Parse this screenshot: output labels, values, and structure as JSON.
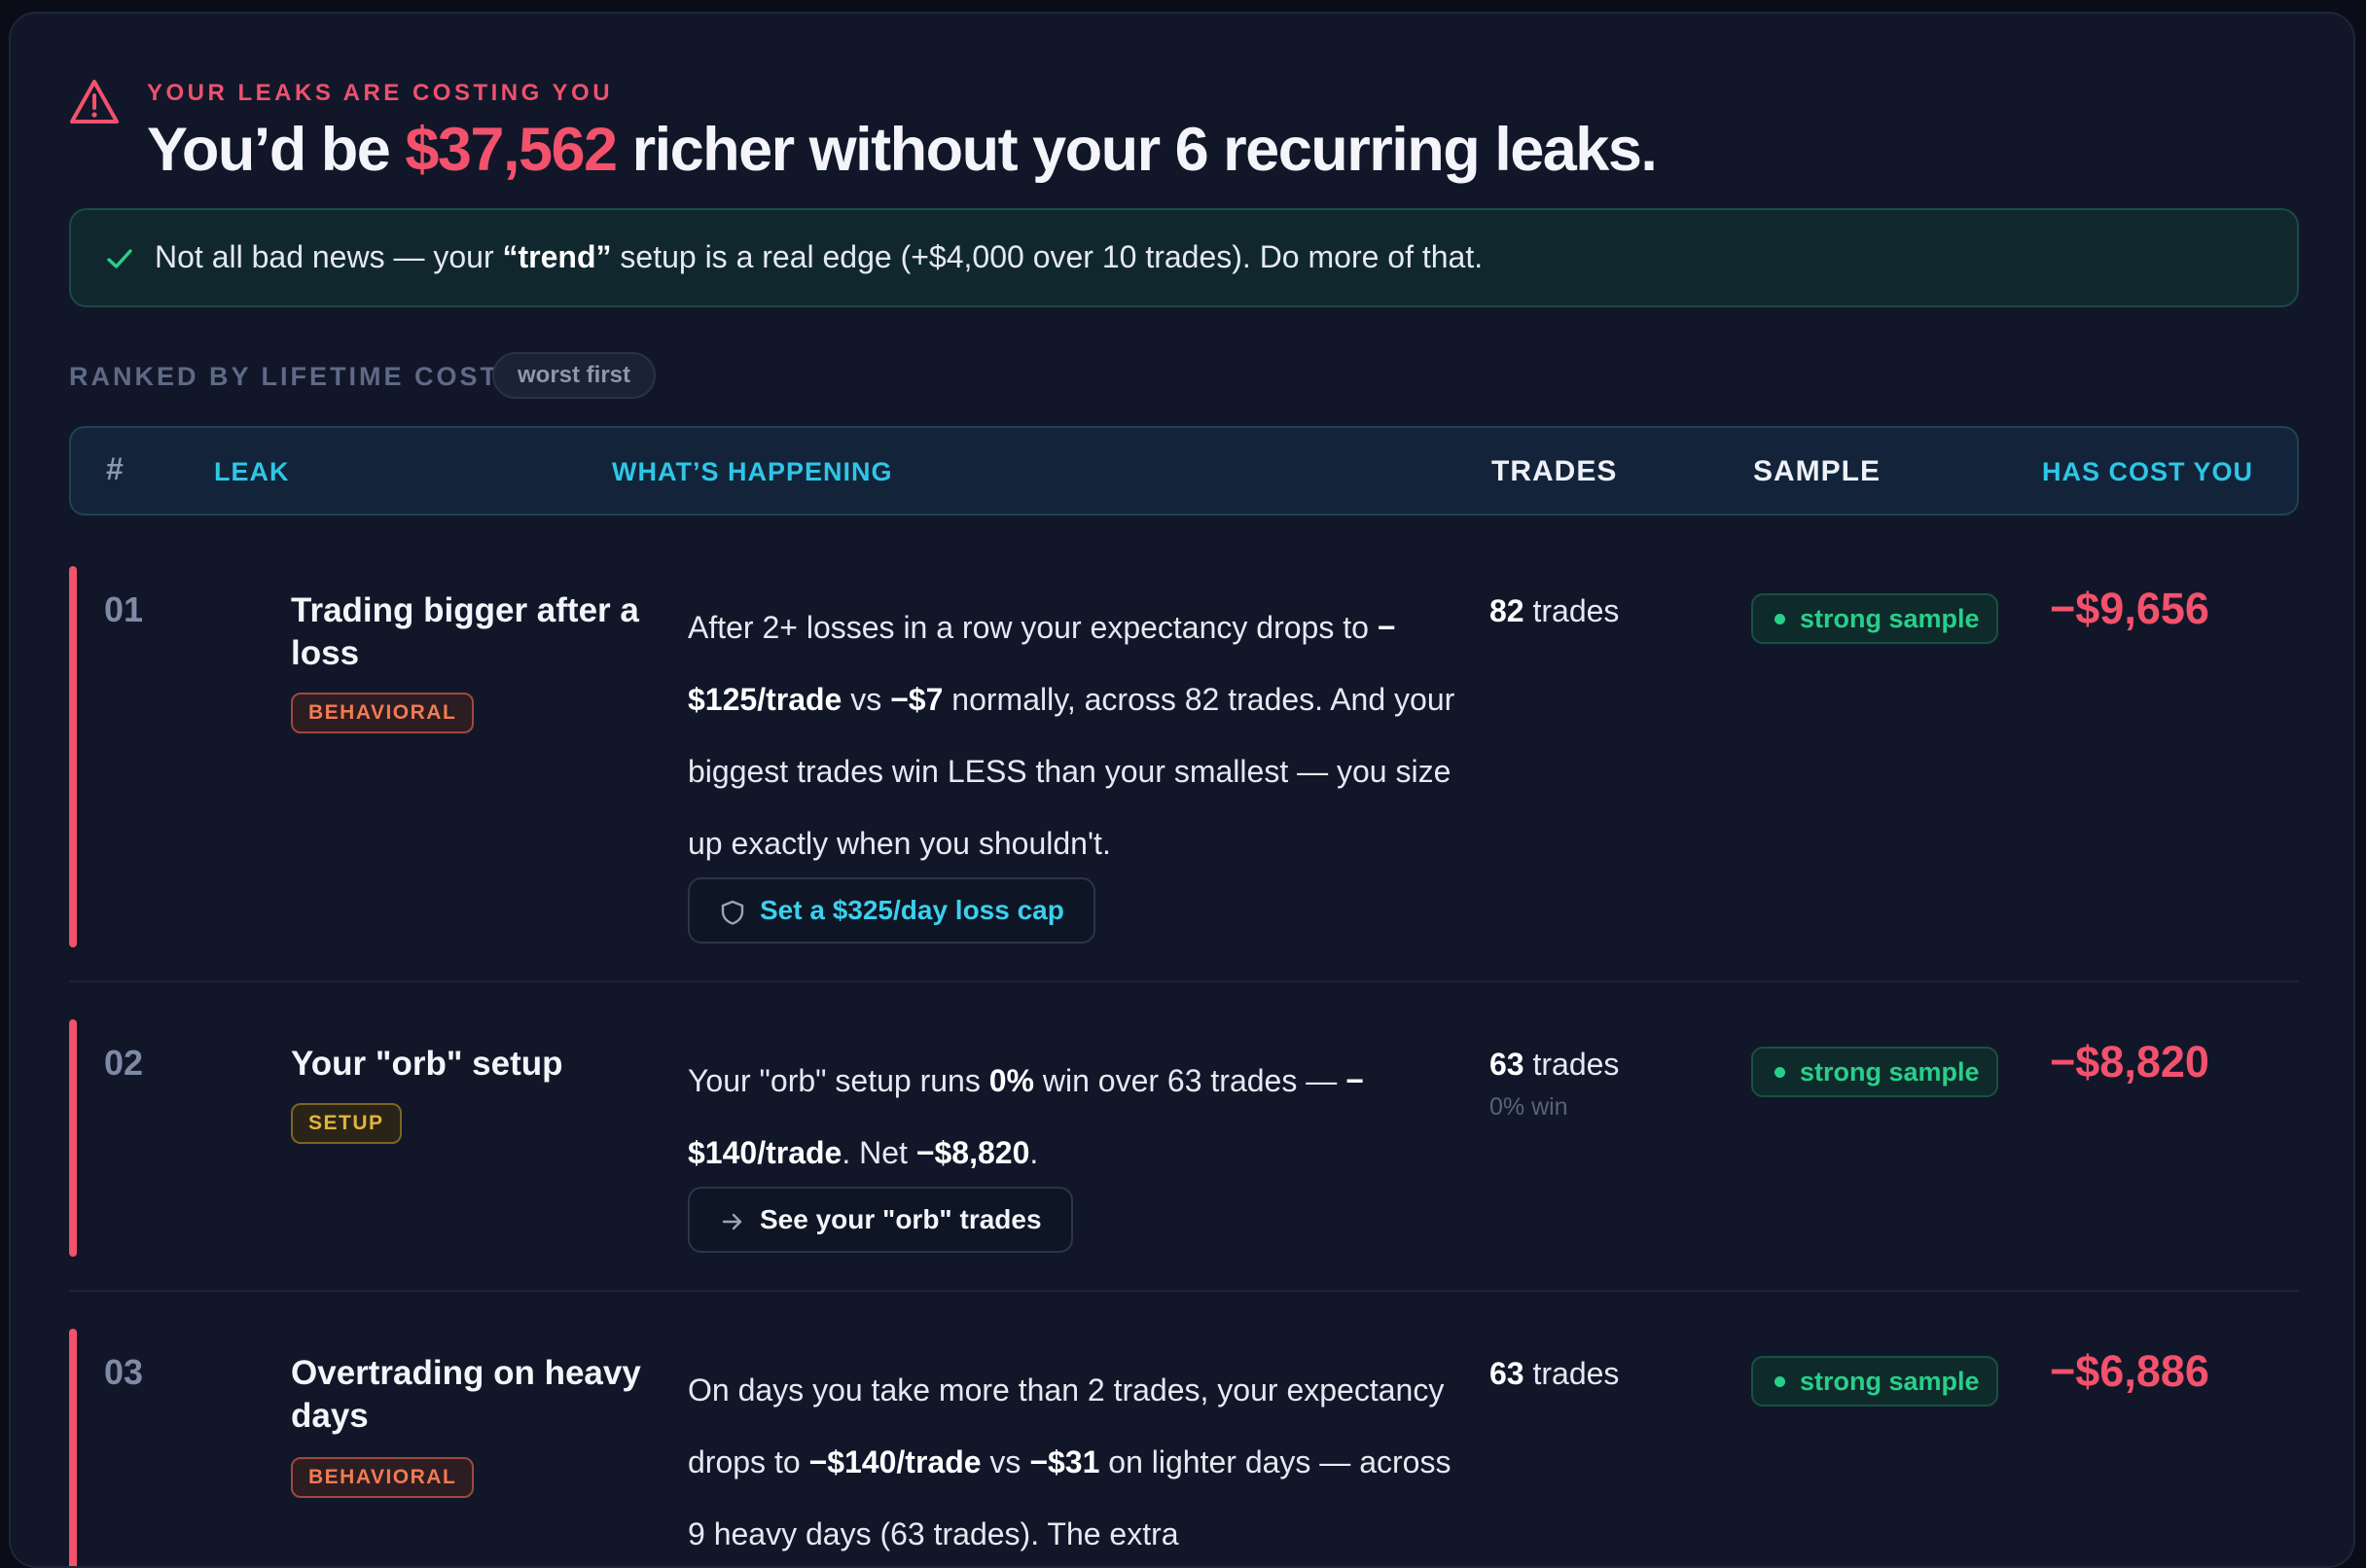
{
  "header": {
    "eyebrow": "YOUR LEAKS ARE COSTING YOU",
    "headline_pre": "You’d be ",
    "headline_amount": "$37,562",
    "headline_post": " richer without your 6 recurring leaks."
  },
  "banner": {
    "pre": "Not all bad news — your ",
    "setup": "“trend”",
    "post": " setup is a real edge (+$4,000 over 10 trades). Do more of that."
  },
  "ranking": {
    "label": "RANKED BY LIFETIME COST",
    "sort_pill": "worst first"
  },
  "columns": {
    "index": "#",
    "leak": "LEAK",
    "whats_happening": "WHAT’S HAPPENING",
    "trades": "TRADES",
    "sample": "SAMPLE",
    "cost": "HAS COST YOU"
  },
  "leaks": [
    {
      "num": "01",
      "title": "Trading bigger after a loss",
      "tag": "BEHAVIORAL",
      "desc": {
        "a": "After 2+ losses in a row your expectancy drops to ",
        "b": "−$125/trade",
        "c": " vs ",
        "d": "−$7",
        "e": " normally, across 82 trades. And your biggest trades win LESS than your smallest — you size up exactly when you shouldn't."
      },
      "action": "Set a $325/day loss cap",
      "trades_count": "82",
      "trades_unit": " trades",
      "sample": "strong sample",
      "cost": "−$9,656"
    },
    {
      "num": "02",
      "title": "Your \"orb\" setup",
      "tag": "SETUP",
      "desc": {
        "a": "Your \"orb\" setup runs ",
        "b": "0%",
        "c": " win over 63 trades — ",
        "d": "−$140/trade",
        "e": ". Net ",
        "f": "−$8,820",
        "g": "."
      },
      "action": "See your \"orb\" trades",
      "trades_count": "63",
      "trades_unit": " trades",
      "win_rate": "0% win",
      "sample": "strong sample",
      "cost": "−$8,820"
    },
    {
      "num": "03",
      "title": "Overtrading on heavy days",
      "tag": "BEHAVIORAL",
      "desc": {
        "a": "On days you take more than 2 trades, your expectancy drops to ",
        "b": "−$140/trade",
        "c": " vs ",
        "d": "−$31",
        "e": " on lighter days — across 9 heavy days (63 trades). The extra"
      },
      "trades_count": "63",
      "trades_unit": " trades",
      "sample": "strong sample",
      "cost": "−$6,886"
    }
  ]
}
